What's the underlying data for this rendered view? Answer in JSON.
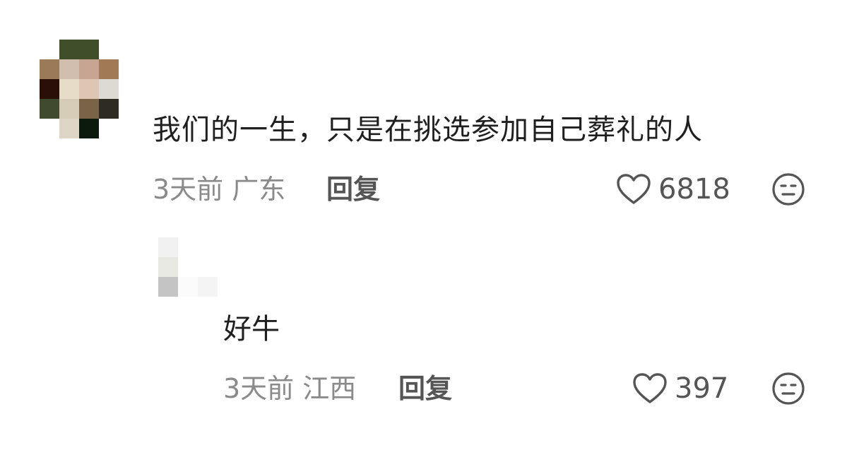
{
  "comments": [
    {
      "avatar_pixels": [
        [
          "#ffffff",
          "#3f4e28",
          "#3f4e28",
          "#ffffff"
        ],
        [
          "#9b7a5a",
          "#d2beae",
          "#c8a492",
          "#a07a55"
        ],
        [
          "#2a0e08",
          "#e6dcc8",
          "#ddc6b4",
          "#dcdad2"
        ],
        [
          "#3f4a2e",
          "#d6cbb6",
          "#7a6448",
          "#2e2c22"
        ],
        [
          "#ffffff",
          "#ded4c6",
          "#0b1a0c",
          "#ffffff"
        ]
      ],
      "text": "我们的一生，只是在挑选参加自己葬礼的人",
      "meta": "3天前 广东",
      "reply_label": "回复",
      "likes": "6818",
      "like_icon": "heart-outline-icon",
      "react_icon": "expressionless-face-icon"
    },
    {
      "avatar_pixels": [
        [
          "#f1f1f1",
          "#ffffff",
          "#ffffff",
          "#ffffff"
        ],
        [
          "#e8e8e2",
          "#ffffff",
          "#ffffff",
          "#ffffff"
        ],
        [
          "#c4c4c4",
          "#fbfbfb",
          "#f4f4f4",
          "#ffffff"
        ]
      ],
      "text": "好牛",
      "meta": "3天前 江西",
      "reply_label": "回复",
      "likes": "397",
      "like_icon": "heart-outline-icon",
      "react_icon": "expressionless-face-icon"
    }
  ],
  "colors": {
    "text": "#1f1f1f",
    "meta": "#8a8a8a",
    "action": "#555555"
  }
}
